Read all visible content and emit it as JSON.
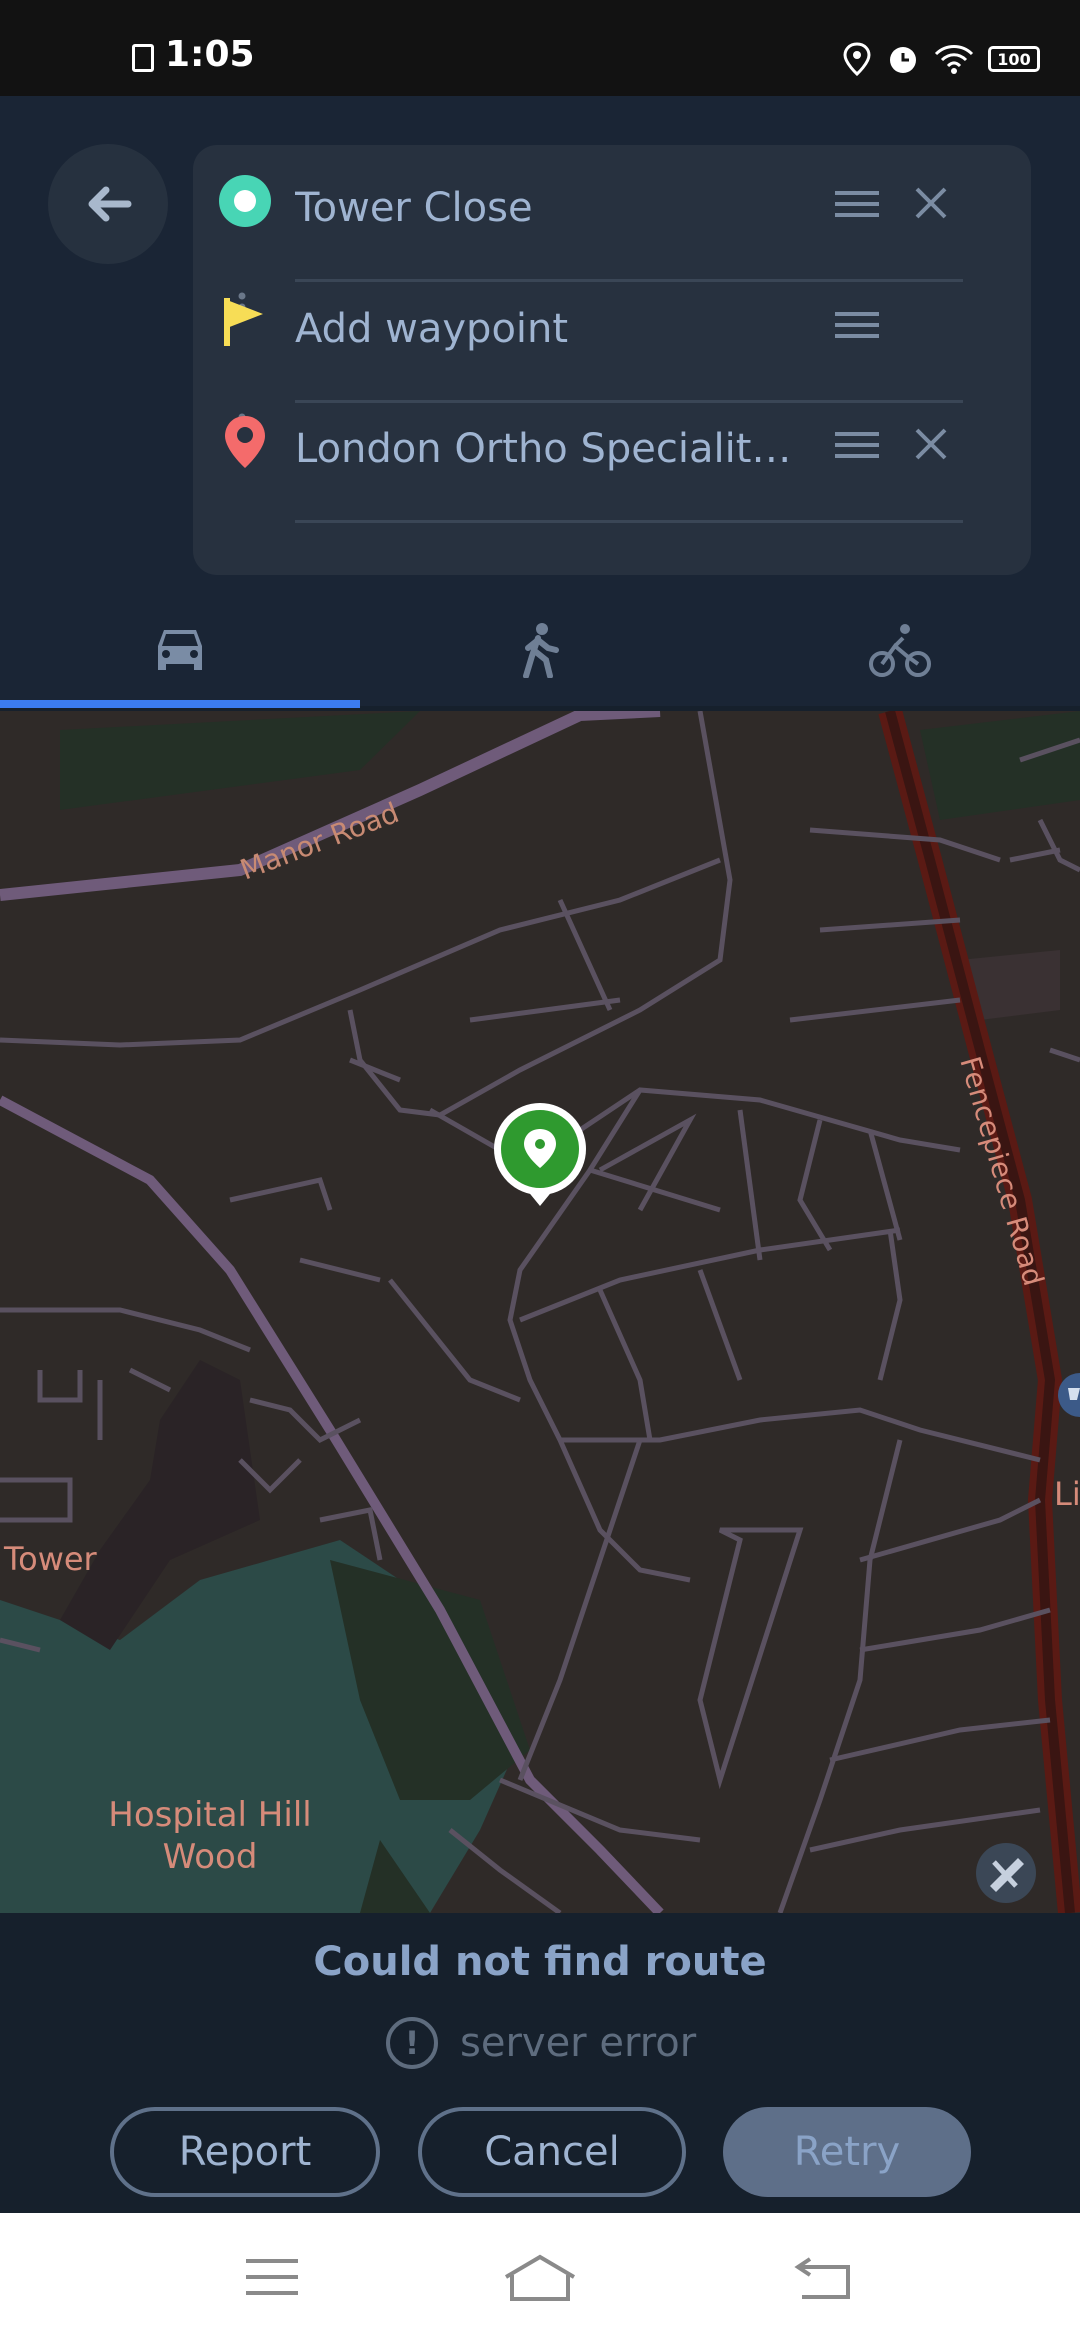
{
  "status_bar": {
    "time": "1:05",
    "battery": "100",
    "icons": [
      "sim-card-icon",
      "location-icon",
      "alarm-icon",
      "wifi-icon",
      "battery-icon"
    ]
  },
  "route": {
    "back_icon": "arrow-left-icon",
    "origin": "Tower Close",
    "waypoint": "Add waypoint",
    "destination": "London Ortho Speciality H..."
  },
  "modes": {
    "items": [
      "car-icon",
      "walk-icon",
      "bike-icon"
    ],
    "selected": "car-icon"
  },
  "map": {
    "labels": {
      "manor_road": "Manor Road",
      "fencepiece_road": "Fencepiece Road",
      "tower": "Tower",
      "hospital_hill_1": "Hospital Hill",
      "hospital_hill_2": "Wood",
      "partial_label": "Li"
    }
  },
  "result": {
    "title": "Could not find route",
    "error": "server error",
    "report": "Report",
    "cancel": "Cancel",
    "retry": "Retry"
  },
  "colors": {
    "accent": "#3c7cf0",
    "origin_marker": "#48d5b5",
    "waypoint_flag": "#f7dd56",
    "destination_pin": "#f46b6b",
    "location_pin": "#2f9a2f"
  }
}
